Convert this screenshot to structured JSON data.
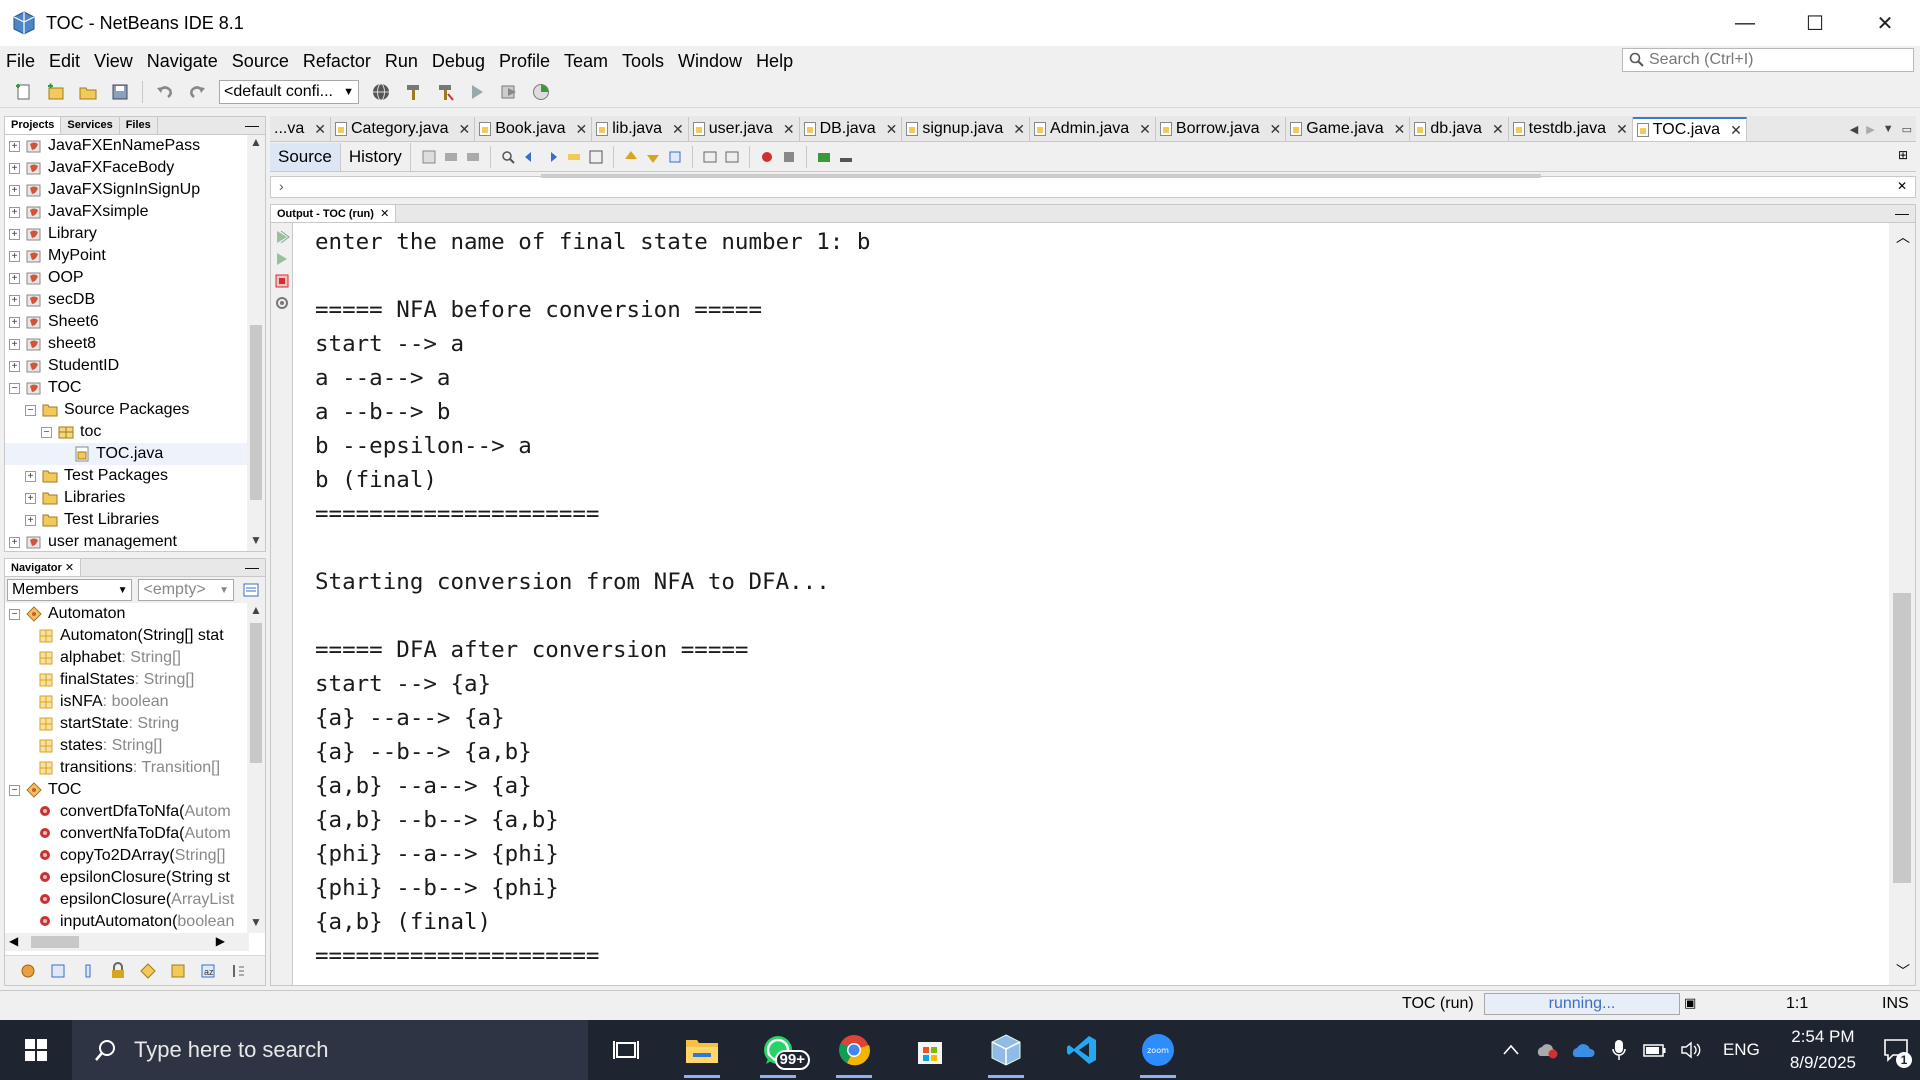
{
  "window": {
    "title": "TOC - NetBeans IDE 8.1",
    "minimize_glyph": "—",
    "maximize_glyph": "☐",
    "close_glyph": "✕"
  },
  "menu": [
    "File",
    "Edit",
    "View",
    "Navigate",
    "Source",
    "Refactor",
    "Run",
    "Debug",
    "Profile",
    "Team",
    "Tools",
    "Window",
    "Help"
  ],
  "search": {
    "placeholder": "Search (Ctrl+I)"
  },
  "toolbar": {
    "config_value": "<default confi..."
  },
  "projects_panel": {
    "tabs": [
      "Projects",
      "Services",
      "Files"
    ],
    "items": [
      {
        "label": "JavaFXEnNamePass",
        "level": 0,
        "expander": "+",
        "icon": "project"
      },
      {
        "label": "JavaFXFaceBody",
        "level": 0,
        "expander": "+",
        "icon": "project"
      },
      {
        "label": "JavaFXSignInSignUp",
        "level": 0,
        "expander": "+",
        "icon": "project"
      },
      {
        "label": "JavaFXsimple",
        "level": 0,
        "expander": "+",
        "icon": "project"
      },
      {
        "label": "Library",
        "level": 0,
        "expander": "+",
        "icon": "project"
      },
      {
        "label": "MyPoint",
        "level": 0,
        "expander": "+",
        "icon": "project"
      },
      {
        "label": "OOP",
        "level": 0,
        "expander": "+",
        "icon": "project"
      },
      {
        "label": "secDB",
        "level": 0,
        "expander": "+",
        "icon": "project"
      },
      {
        "label": "Sheet6",
        "level": 0,
        "expander": "+",
        "icon": "project"
      },
      {
        "label": "sheet8",
        "level": 0,
        "expander": "+",
        "icon": "project"
      },
      {
        "label": "StudentID",
        "level": 0,
        "expander": "+",
        "icon": "project"
      },
      {
        "label": "TOC",
        "level": 0,
        "expander": "−",
        "icon": "project"
      },
      {
        "label": "Source Packages",
        "level": 1,
        "expander": "−",
        "icon": "folder"
      },
      {
        "label": "toc",
        "level": 2,
        "expander": "−",
        "icon": "package"
      },
      {
        "label": "TOC.java",
        "level": 3,
        "expander": "",
        "icon": "java"
      },
      {
        "label": "Test Packages",
        "level": 1,
        "expander": "+",
        "icon": "folder"
      },
      {
        "label": "Libraries",
        "level": 1,
        "expander": "+",
        "icon": "folder"
      },
      {
        "label": "Test Libraries",
        "level": 1,
        "expander": "+",
        "icon": "folder"
      },
      {
        "label": "user management",
        "level": 0,
        "expander": "+",
        "icon": "project"
      }
    ]
  },
  "navigator": {
    "tab": "Navigator",
    "filter_members": "Members",
    "filter_empty": "<empty>",
    "items": [
      {
        "name": "Automaton",
        "type": "",
        "level": 0,
        "expander": "−",
        "icon": "class"
      },
      {
        "name": "Automaton(String[] stat",
        "type": "",
        "level": 1,
        "expander": "",
        "icon": "field"
      },
      {
        "name": "alphabet",
        "type": " : String[]",
        "level": 1,
        "expander": "",
        "icon": "field"
      },
      {
        "name": "finalStates",
        "type": " : String[]",
        "level": 1,
        "expander": "",
        "icon": "field"
      },
      {
        "name": "isNFA",
        "type": " : boolean",
        "level": 1,
        "expander": "",
        "icon": "field"
      },
      {
        "name": "startState",
        "type": " : String",
        "level": 1,
        "expander": "",
        "icon": "field"
      },
      {
        "name": "states",
        "type": " : String[]",
        "level": 1,
        "expander": "",
        "icon": "field"
      },
      {
        "name": "transitions",
        "type": " : Transition[]",
        "level": 1,
        "expander": "",
        "icon": "field"
      },
      {
        "name": "TOC",
        "type": "",
        "level": 0,
        "expander": "−",
        "icon": "class"
      },
      {
        "name": "convertDfaToNfa(",
        "type": "Autom",
        "level": 1,
        "expander": "",
        "icon": "method"
      },
      {
        "name": "convertNfaToDfa(",
        "type": "Autom",
        "level": 1,
        "expander": "",
        "icon": "method"
      },
      {
        "name": "copyTo2DArray(",
        "type": "String[]",
        "level": 1,
        "expander": "",
        "icon": "method"
      },
      {
        "name": "epsilonClosure(String st",
        "type": "",
        "level": 1,
        "expander": "",
        "icon": "method"
      },
      {
        "name": "epsilonClosure(",
        "type": "ArrayList",
        "level": 1,
        "expander": "",
        "icon": "method"
      },
      {
        "name": "inputAutomaton(",
        "type": "boolean",
        "level": 1,
        "expander": "",
        "icon": "method"
      }
    ]
  },
  "editor_tabs": [
    {
      "label": "...va",
      "active": false
    },
    {
      "label": "Category.java",
      "active": false
    },
    {
      "label": "Book.java",
      "active": false
    },
    {
      "label": "lib.java",
      "active": false
    },
    {
      "label": "user.java",
      "active": false
    },
    {
      "label": "DB.java",
      "active": false
    },
    {
      "label": "signup.java",
      "active": false
    },
    {
      "label": "Admin.java",
      "active": false
    },
    {
      "label": "Borrow.java",
      "active": false
    },
    {
      "label": "Game.java",
      "active": false
    },
    {
      "label": "db.java",
      "active": false
    },
    {
      "label": "testdb.java",
      "active": false
    },
    {
      "label": "TOC.java",
      "active": true
    }
  ],
  "source_bar": {
    "source_label": "Source",
    "history_label": "History"
  },
  "output": {
    "tab_label": "Output - TOC (run)",
    "lines": [
      "enter the name of final state number 1: b",
      "",
      "===== NFA before conversion =====",
      "start --> a",
      "a --a--> a",
      "a --b--> b",
      "b --epsilon--> a",
      "b (final)",
      "=====================",
      "",
      "Starting conversion from NFA to DFA...",
      "",
      "===== DFA after conversion =====",
      "start --> {a}",
      "{a} --a--> {a}",
      "{a} --b--> {a,b}",
      "{a,b} --a--> {a}",
      "{a,b} --b--> {a,b}",
      "{phi} --a--> {phi}",
      "{phi} --b--> {phi}",
      "{a,b} (final)",
      "====================="
    ]
  },
  "statusbar": {
    "run_label": "TOC (run)",
    "progress_text": "running...",
    "position": "1:1",
    "mode": "INS"
  },
  "taskbar": {
    "search_placeholder": "Type here to search",
    "whatsapp_badge": "99+",
    "language": "ENG",
    "time": "2:54 PM",
    "date": "8/9/2025",
    "notification_count": "1"
  },
  "colors": {
    "accent": "#3a7ad8",
    "taskbar_bg": "#1f2431",
    "project_icon": "#d2553a",
    "method_icon": "#c83232",
    "field_icon": "#d9a520"
  }
}
